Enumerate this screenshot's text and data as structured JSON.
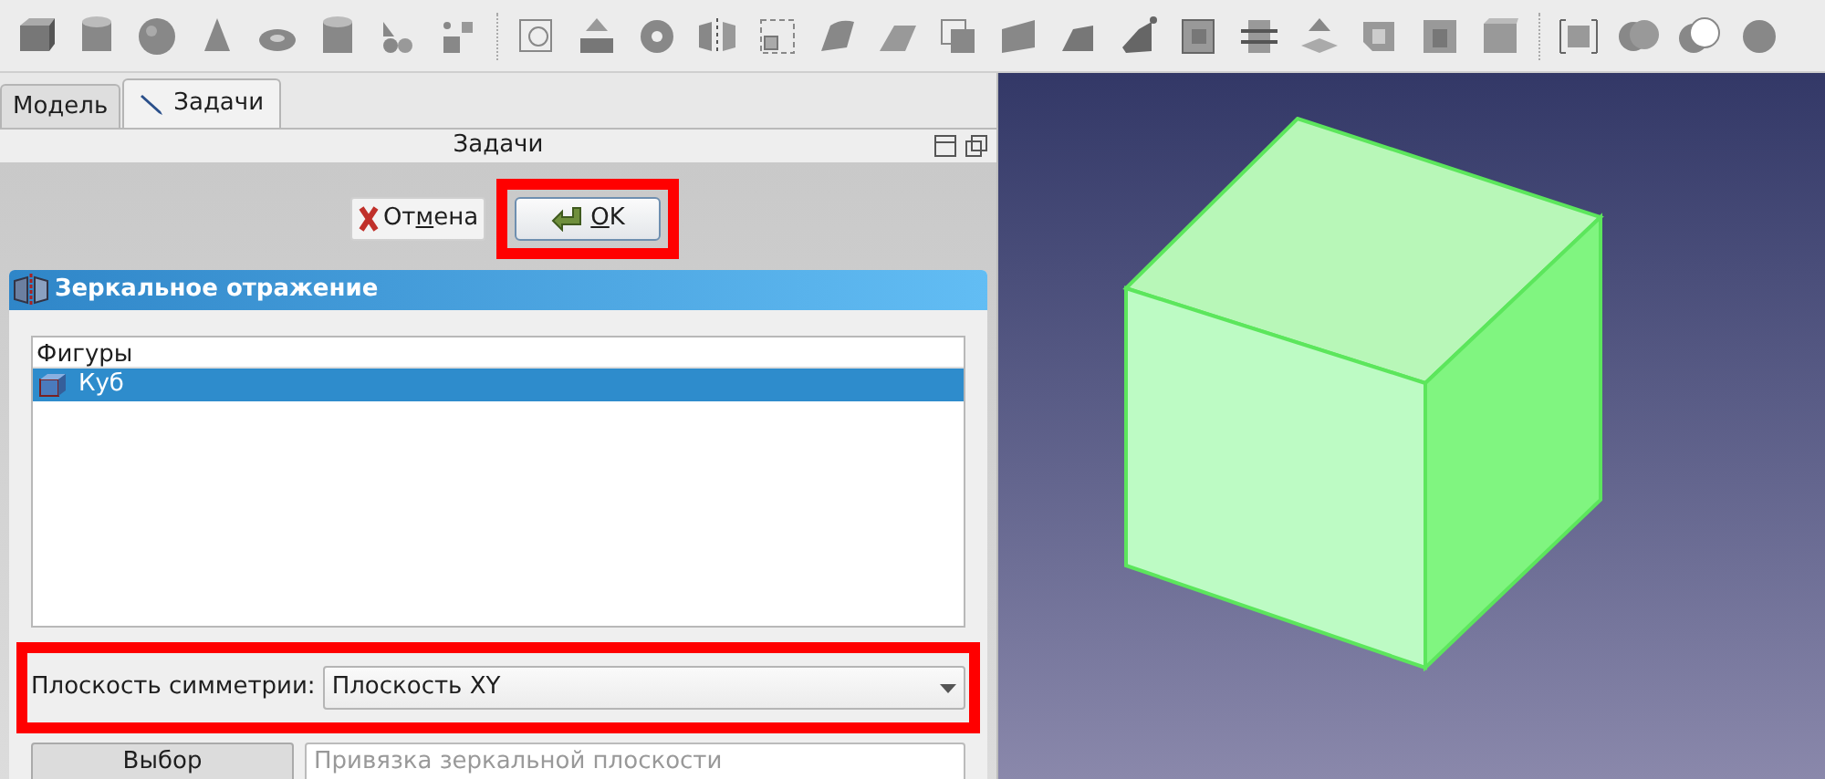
{
  "tabs": [
    {
      "label": "Модель",
      "selected": false,
      "icon": false
    },
    {
      "label": "Задачи",
      "selected": true,
      "icon": true
    }
  ],
  "panel_title": "Задачи",
  "dialog_buttons": [
    {
      "kind": "cancel",
      "label_before": "От",
      "mnemonic": "м",
      "label_after": "ена",
      "highlighted": false
    },
    {
      "kind": "ok",
      "mnemonic": "O",
      "label_after": "K",
      "highlighted": true
    }
  ],
  "section": {
    "title": "Зеркальное отражение",
    "list": {
      "header": "Фигуры",
      "items": [
        {
          "label": "Куб",
          "selected": true
        }
      ]
    },
    "plane": {
      "label": "Плоскость симметрии:",
      "value": "Плоскость XY",
      "highlighted": true
    },
    "select_button": "Выбор",
    "reference_field": {
      "placeholder": "Привязка зеркальной плоскости"
    }
  }
}
